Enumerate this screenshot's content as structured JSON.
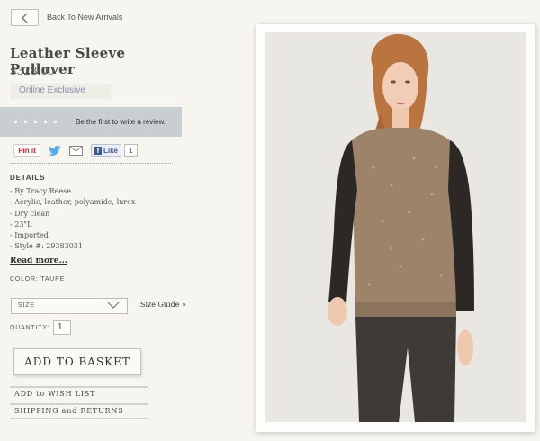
{
  "nav": {
    "back_label": "Back To New Arrivals"
  },
  "product": {
    "title": "Leather Sleeve Pullover",
    "price": "$328.00",
    "badge": "Online Exclusive",
    "review_prompt": "Be the first to write a review.",
    "rating_stars": 5
  },
  "share": {
    "pin_label": "Pin it",
    "like_label": "Like",
    "like_count": "1"
  },
  "details": {
    "heading": "DETAILS",
    "items": [
      "- By Tracy Reese",
      "- Acrylic, leather, polyamide, lurex",
      "- Dry clean",
      "- 23\"L",
      "- Imported",
      "- Style #: 29383031"
    ],
    "read_more": "Read more..."
  },
  "options": {
    "color_label": "COLOR: TAUPE",
    "size_placeholder": "SIZE",
    "size_guide": "Size Guide »",
    "quantity_label": "QUANTITY:",
    "quantity_value": "1"
  },
  "actions": {
    "add_to_basket": "ADD TO BASKET",
    "wish_list": "ADD to WISH LIST",
    "shipping": "SHIPPING and RETURNS"
  },
  "colors": {
    "review_bar": "#c9cfd0",
    "badge_text": "#8a8fb2",
    "facebook": "#3b5998",
    "pinterest": "#c8232c"
  },
  "image": {
    "icon": "product-photo"
  }
}
